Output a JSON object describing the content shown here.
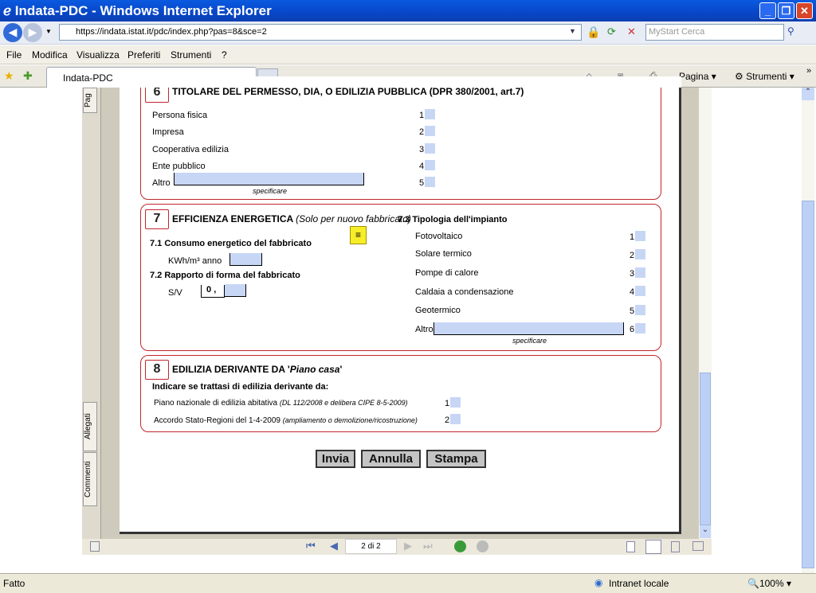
{
  "window": {
    "title": "Indata-PDC - Windows Internet Explorer"
  },
  "address": {
    "url": "https://indata.istat.it/pdc/index.php?pas=8&sce=2",
    "search_placeholder": "MyStart Cerca"
  },
  "menu": [
    "File",
    "Modifica",
    "Visualizza",
    "Preferiti",
    "Strumenti",
    "?"
  ],
  "tab": {
    "label": "Indata-PDC"
  },
  "toolbar": {
    "pagina": "Pagina",
    "strumenti": "Strumenti",
    "more": "»"
  },
  "sidebar_tabs": [
    "Pag",
    "Allegati",
    "Commenti"
  ],
  "section6": {
    "num": "6",
    "title": "TITOLARE DEL PERMESSO, DIA, O EDILIZIA PUBBLICA (DPR 380/2001, art.7)",
    "options": [
      {
        "label": "Persona fisica",
        "code": "1"
      },
      {
        "label": "Impresa",
        "code": "2"
      },
      {
        "label": "Cooperativa edilizia",
        "code": "3"
      },
      {
        "label": "Ente pubblico",
        "code": "4"
      },
      {
        "label": "Altro",
        "code": "5"
      }
    ],
    "specify": "specificare"
  },
  "section7": {
    "num": "7",
    "title": "EFFICIENZA ENERGETICA",
    "subtitle": "(Solo per nuovo fabbricato)",
    "s71": "7.1  Consumo energetico del fabbricato",
    "unit": "KWh/m³ anno",
    "s72": "7.2  Rapporto di forma del fabbricato",
    "sv": "S/V",
    "sv_prefix": "0",
    "sv_sep": ",",
    "s73": "7.3  Tipologia dell'impianto",
    "options": [
      {
        "label": "Fotovoltaico",
        "code": "1"
      },
      {
        "label": "Solare termico",
        "code": "2"
      },
      {
        "label": "Pompe di calore",
        "code": "3"
      },
      {
        "label": "Caldaia a condensazione",
        "code": "4"
      },
      {
        "label": "Geotermico",
        "code": "5"
      },
      {
        "label": "Altro",
        "code": "6"
      }
    ],
    "specify": "specificare"
  },
  "section8": {
    "num": "8",
    "title": "EDILIZIA DERIVANTE DA '",
    "title_italic": "Piano casa",
    "title_end": "'",
    "instruction": "Indicare se trattasi di edilizia derivante da:",
    "options": [
      {
        "label": "Piano nazionale di edilizia abitativa ",
        "note": "(DL 112/2008 e delibera CIPE 8-5-2009)",
        "code": "1"
      },
      {
        "label": "Accordo Stato-Regioni del 1-4-2009 ",
        "note": "(ampliamento o demolizione/ricostruzione)",
        "code": "2"
      }
    ]
  },
  "buttons": {
    "send": "Invia",
    "cancel": "Annulla",
    "print": "Stampa"
  },
  "pdf": {
    "page_indicator": "2 di 2"
  },
  "status": {
    "text": "Fatto",
    "zone": "Intranet locale",
    "zoom": "100%"
  }
}
